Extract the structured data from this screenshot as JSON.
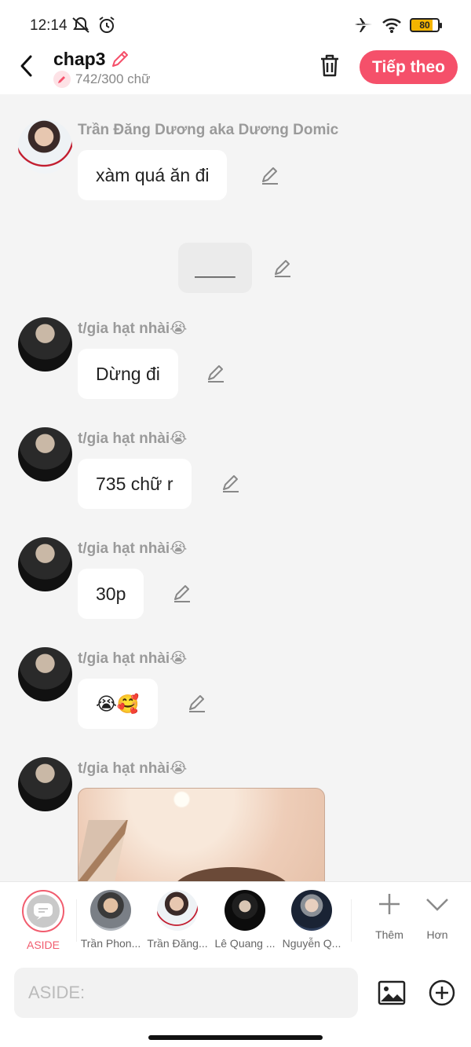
{
  "status_bar": {
    "time": "12:14",
    "battery": "80",
    "icons_left": [
      "mute-icon",
      "alarm-icon"
    ],
    "icons_right": [
      "airplane-icon",
      "wifi-icon",
      "battery-icon"
    ]
  },
  "header": {
    "title": "chap3",
    "word_count": "742/300 chữ",
    "next_label": "Tiếp theo"
  },
  "messages": [
    {
      "sender": "Trần Đăng Dương aka Dương Domic",
      "text": "xàm quá ăn đi"
    },
    {
      "system_text": "____"
    },
    {
      "sender": "t/gia hạt nhài😭",
      "text": "Dừng đi"
    },
    {
      "sender": "t/gia hạt nhài😭",
      "text": "735 chữ r"
    },
    {
      "sender": "t/gia hạt nhài😭",
      "text": "30p"
    },
    {
      "sender": "t/gia hạt nhài😭",
      "text": "😭🥰"
    },
    {
      "sender": "t/gia hạt nhài😭",
      "image": "photo"
    }
  ],
  "characters": [
    {
      "label": "ASIDE",
      "selected": true
    },
    {
      "label": "Trần Phon..."
    },
    {
      "label": "Trần Đăng..."
    },
    {
      "label": "Lê Quang ..."
    },
    {
      "label": "Nguyễn Q..."
    }
  ],
  "tools": {
    "more_label": "Thêm",
    "less_label": "Hơn"
  },
  "input": {
    "placeholder": "ASIDE:",
    "value": ""
  },
  "colors": {
    "accent": "#f5506a",
    "background": "#f4f4f4"
  }
}
